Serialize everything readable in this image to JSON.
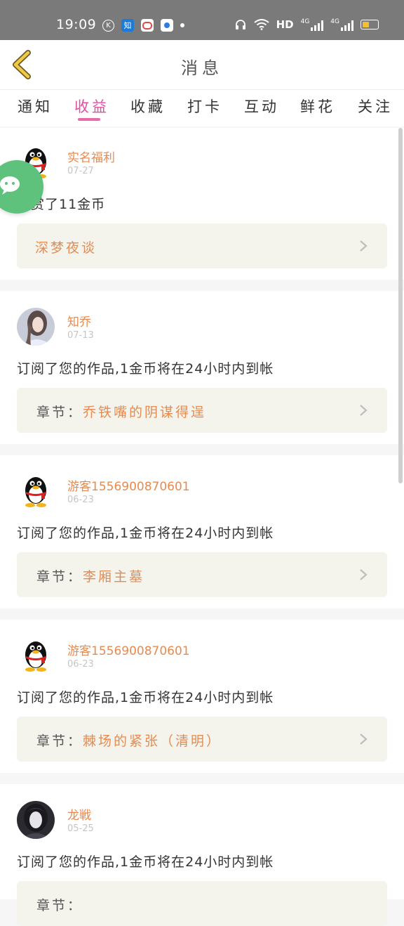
{
  "status_bar": {
    "time": "19:09",
    "left_icons": [
      "k-icon",
      "zhihu-icon",
      "red-app-icon",
      "blue-app-icon",
      "dot-icon"
    ],
    "right_icons": [
      "headphone-icon",
      "wifi-icon",
      "hd-icon",
      "signal-4g-icon",
      "signal-4g-icon",
      "battery-icon"
    ],
    "hd_label": "HD",
    "net1": "4G",
    "net2": "4G"
  },
  "header": {
    "title": "消息",
    "back_icon": "back-chevron-icon"
  },
  "tabs": [
    {
      "label": "通知",
      "active": false
    },
    {
      "label": "收益",
      "active": true
    },
    {
      "label": "收藏",
      "active": false
    },
    {
      "label": "打卡",
      "active": false
    },
    {
      "label": "互动",
      "active": false
    },
    {
      "label": "鲜花",
      "active": false
    },
    {
      "label": "关注",
      "active": false
    }
  ],
  "messages": [
    {
      "user": "实名福利",
      "date": "07-27",
      "avatar": "qq-penguin",
      "text": "打赏了11金币",
      "box_prefix": "",
      "box_title": "深梦夜谈"
    },
    {
      "user": "知乔",
      "date": "07-13",
      "avatar": "photo-girl",
      "text": "订阅了您的作品,1金币将在24小时内到帐",
      "box_prefix": "章节：",
      "box_title": "乔铁嘴的阴谋得逞"
    },
    {
      "user": "游客15569008706​01",
      "date": "06-23",
      "avatar": "qq-penguin",
      "text": "订阅了您的作品,1金币将在24小时内到帐",
      "box_prefix": "章节：",
      "box_title": "李厢主墓"
    },
    {
      "user": "游客15569008706​01",
      "date": "06-23",
      "avatar": "qq-penguin",
      "text": "订阅了您的作品,1金币将在24小时内到帐",
      "box_prefix": "章节：",
      "box_title": "棘场的紧张（清明）"
    },
    {
      "user": "龙戦",
      "date": "05-25",
      "avatar": "photo-dark",
      "text": "订阅了您的作品,1金币将在24小时内到帐",
      "box_prefix": "章节：",
      "box_title": ""
    }
  ],
  "floating": {
    "icon": "wechat-icon"
  },
  "colors": {
    "accent": "#e14ea2",
    "name": "#e58b52",
    "box_bg": "#f4f4ec"
  }
}
